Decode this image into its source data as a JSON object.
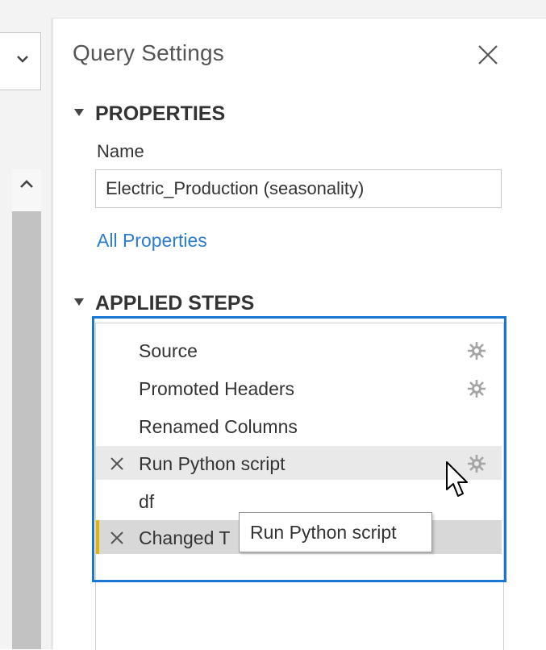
{
  "panel": {
    "title": "Query Settings"
  },
  "properties": {
    "heading": "PROPERTIES",
    "name_label": "Name",
    "name_value": "Electric_Production (seasonality)",
    "all_properties_link": "All Properties"
  },
  "applied_steps": {
    "heading": "APPLIED STEPS",
    "steps": [
      {
        "label": "Source",
        "has_settings": true,
        "deletable": false,
        "state": "normal"
      },
      {
        "label": "Promoted Headers",
        "has_settings": true,
        "deletable": false,
        "state": "normal"
      },
      {
        "label": "Renamed Columns",
        "has_settings": false,
        "deletable": false,
        "state": "normal"
      },
      {
        "label": "Run Python script",
        "has_settings": true,
        "deletable": true,
        "state": "hover"
      },
      {
        "label": "df",
        "has_settings": false,
        "deletable": false,
        "state": "normal"
      },
      {
        "label": "Changed T",
        "has_settings": false,
        "deletable": true,
        "state": "selected"
      }
    ]
  },
  "tooltip": {
    "text": "Run Python script"
  },
  "colors": {
    "accent_blue": "#1976d2",
    "link_blue": "#2a7dd1",
    "selected_marker": "#e8b100"
  }
}
